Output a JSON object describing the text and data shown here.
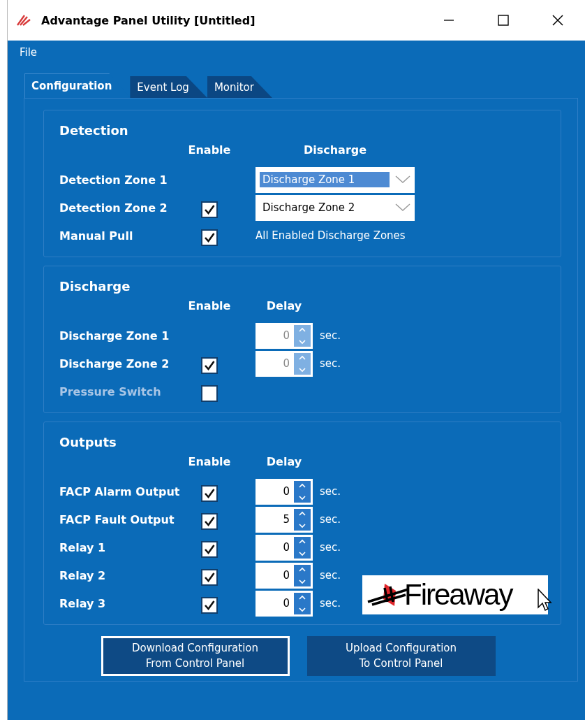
{
  "window": {
    "title": "Advantage Panel Utility [Untitled]"
  },
  "menu": [
    "File"
  ],
  "tabs": [
    {
      "label": "Configuration",
      "selected": true
    },
    {
      "label": "Event Log",
      "selected": false
    },
    {
      "label": "Monitor",
      "selected": false
    }
  ],
  "groups": [
    {
      "title": "Detection",
      "column_headers": [
        "Enable",
        "Discharge"
      ],
      "rows": [
        {
          "label": "Detection Zone 1",
          "disabled": false,
          "enable": {
            "kind": "none"
          },
          "value": {
            "kind": "dropdown",
            "text": "Discharge Zone 1",
            "selected": true
          }
        },
        {
          "label": "Detection Zone 2",
          "disabled": false,
          "enable": {
            "kind": "checkbox",
            "checked": true
          },
          "value": {
            "kind": "dropdown",
            "text": "Discharge Zone 2",
            "selected": false
          }
        },
        {
          "label": "Manual Pull",
          "disabled": false,
          "enable": {
            "kind": "checkbox",
            "checked": true
          },
          "value": {
            "kind": "text",
            "text": "All Enabled Discharge Zones"
          }
        }
      ]
    },
    {
      "title": "Discharge",
      "column_headers": [
        "Enable",
        "Delay"
      ],
      "rows": [
        {
          "label": "Discharge Zone 1",
          "disabled": false,
          "enable": {
            "kind": "none"
          },
          "value": {
            "kind": "spinner",
            "text": "0",
            "unit": "sec.",
            "disabled": true
          }
        },
        {
          "label": "Discharge Zone 2",
          "disabled": false,
          "enable": {
            "kind": "checkbox",
            "checked": true
          },
          "value": {
            "kind": "spinner",
            "text": "0",
            "unit": "sec.",
            "disabled": true
          }
        },
        {
          "label": "Pressure Switch",
          "disabled": true,
          "enable": {
            "kind": "checkbox",
            "checked": false
          },
          "value": {
            "kind": "none"
          }
        }
      ]
    },
    {
      "title": "Outputs",
      "column_headers": [
        "Enable",
        "Delay"
      ],
      "logo": "Fireaway",
      "rows": [
        {
          "label": "FACP Alarm Output",
          "disabled": false,
          "enable": {
            "kind": "checkbox",
            "checked": true
          },
          "value": {
            "kind": "spinner",
            "text": "0",
            "unit": "sec.",
            "disabled": false
          }
        },
        {
          "label": "FACP Fault Output",
          "disabled": false,
          "enable": {
            "kind": "checkbox",
            "checked": true
          },
          "value": {
            "kind": "spinner",
            "text": "5",
            "unit": "sec.",
            "disabled": false
          }
        },
        {
          "label": "Relay 1",
          "disabled": false,
          "enable": {
            "kind": "checkbox",
            "checked": true
          },
          "value": {
            "kind": "spinner",
            "text": "0",
            "unit": "sec.",
            "disabled": false
          }
        },
        {
          "label": "Relay 2",
          "disabled": false,
          "enable": {
            "kind": "checkbox",
            "checked": true
          },
          "value": {
            "kind": "spinner",
            "text": "0",
            "unit": "sec.",
            "disabled": false
          }
        },
        {
          "label": "Relay 3",
          "disabled": false,
          "enable": {
            "kind": "checkbox",
            "checked": true
          },
          "value": {
            "kind": "spinner",
            "text": "0",
            "unit": "sec.",
            "disabled": false
          }
        }
      ]
    }
  ],
  "buttons": [
    {
      "lines": [
        "Download Configuration",
        "From Control Panel"
      ],
      "focused": true
    },
    {
      "lines": [
        "Upload Configuration",
        "To Control Panel"
      ],
      "focused": false
    }
  ]
}
